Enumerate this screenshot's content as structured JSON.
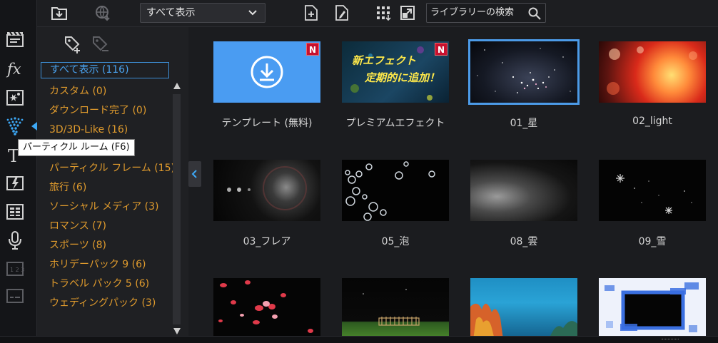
{
  "toolbar": {
    "icons": [
      "import-media-icon",
      "download-web-icon",
      "new-particle-icon",
      "edit-particle-icon",
      "grid-view-icon",
      "expand-icon"
    ],
    "filter_value": "すべて表示",
    "search_placeholder": "ライブラリーの検索"
  },
  "rail": {
    "icons": [
      "media-room-icon",
      "fx-icon",
      "pip-icon",
      "particle-room-icon",
      "title-icon",
      "transition-icon",
      "audio-mix-icon",
      "voiceover-icon",
      "chapter-icon",
      "subtitle-icon"
    ],
    "active": "particle-room-icon"
  },
  "tooltip": "パーティクル ルーム (F6)",
  "categories": [
    {
      "label": "すべて表示 (116)",
      "selected": true
    },
    {
      "label": "カスタム (0)",
      "selected": false
    },
    {
      "label": "ダウンロード完了 (0)",
      "selected": false
    },
    {
      "label": "3D/3D-Like (16)",
      "selected": false
    },
    {
      "label": "パーティクル フレーム (15)",
      "selected": false
    },
    {
      "label": "旅行 (6)",
      "selected": false
    },
    {
      "label": "ソーシャル メディア (3)",
      "selected": false
    },
    {
      "label": "ロマンス (7)",
      "selected": false
    },
    {
      "label": "スポーツ (8)",
      "selected": false
    },
    {
      "label": "ホリデーパック 9 (6)",
      "selected": false
    },
    {
      "label": "トラベル パック 5 (6)",
      "selected": false
    },
    {
      "label": "ウェディングパック (3)",
      "selected": false
    }
  ],
  "items": [
    {
      "label": "テンプレート (無料)",
      "badge": "N",
      "theme": "template"
    },
    {
      "label": "プレミアムエフェクト",
      "badge": "N",
      "theme": "premium",
      "text1": "新エフェクト",
      "text2": "定期的に追加！"
    },
    {
      "label": "01_星",
      "badge": "",
      "theme": "stars",
      "selected": true
    },
    {
      "label": "02_light",
      "badge": "",
      "theme": "light"
    },
    {
      "label": "03_フレア",
      "badge": "",
      "theme": "flare"
    },
    {
      "label": "05_泡",
      "badge": "",
      "theme": "bubbles"
    },
    {
      "label": "08_雲",
      "badge": "",
      "theme": "cloud"
    },
    {
      "label": "09_雪",
      "badge": "",
      "theme": "snow"
    },
    {
      "label": "",
      "badge": "",
      "theme": "petals"
    },
    {
      "label": "",
      "badge": "",
      "theme": "fence"
    },
    {
      "label": "",
      "badge": "",
      "theme": "coral"
    },
    {
      "label": "",
      "badge": "",
      "theme": "frame"
    }
  ]
}
